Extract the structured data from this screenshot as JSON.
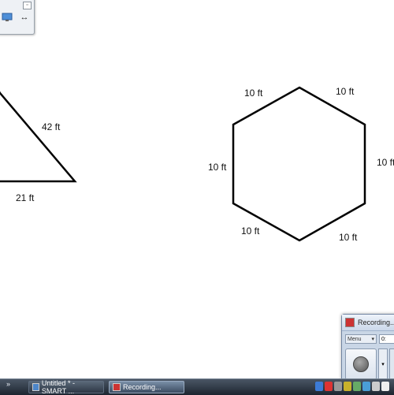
{
  "toolbar": {
    "close_glyph": "▫",
    "items": [
      {
        "icon": "monitor-icon"
      },
      {
        "icon": "resize-arrows-icon"
      }
    ],
    "arrows_glyph": "↔"
  },
  "canvas": {
    "triangle": {
      "labels": {
        "hypotenuse": "42 ft",
        "base": "21 ft"
      }
    },
    "hexagon": {
      "labels": [
        "10 ft",
        "10 ft",
        "10 ft",
        "10 ft",
        "10 ft",
        "10 ft"
      ]
    }
  },
  "recording_window": {
    "title": "Recording...",
    "menu_label": "Menu",
    "time": "0:",
    "record_button_icon": "record-icon",
    "dropdown_glyph": "▾"
  },
  "taskbar": {
    "overflow_glyph": "»",
    "items": [
      {
        "label": "Untitled * - SMART ...",
        "icon": "smart-icon"
      },
      {
        "label": "Recording...",
        "icon": "recording-icon"
      }
    ],
    "tray_colors": [
      "#3c7bd6",
      "#d33",
      "#999",
      "#c8b12b",
      "#6a6",
      "#4a9ed6",
      "#ccc",
      "#eee"
    ]
  }
}
